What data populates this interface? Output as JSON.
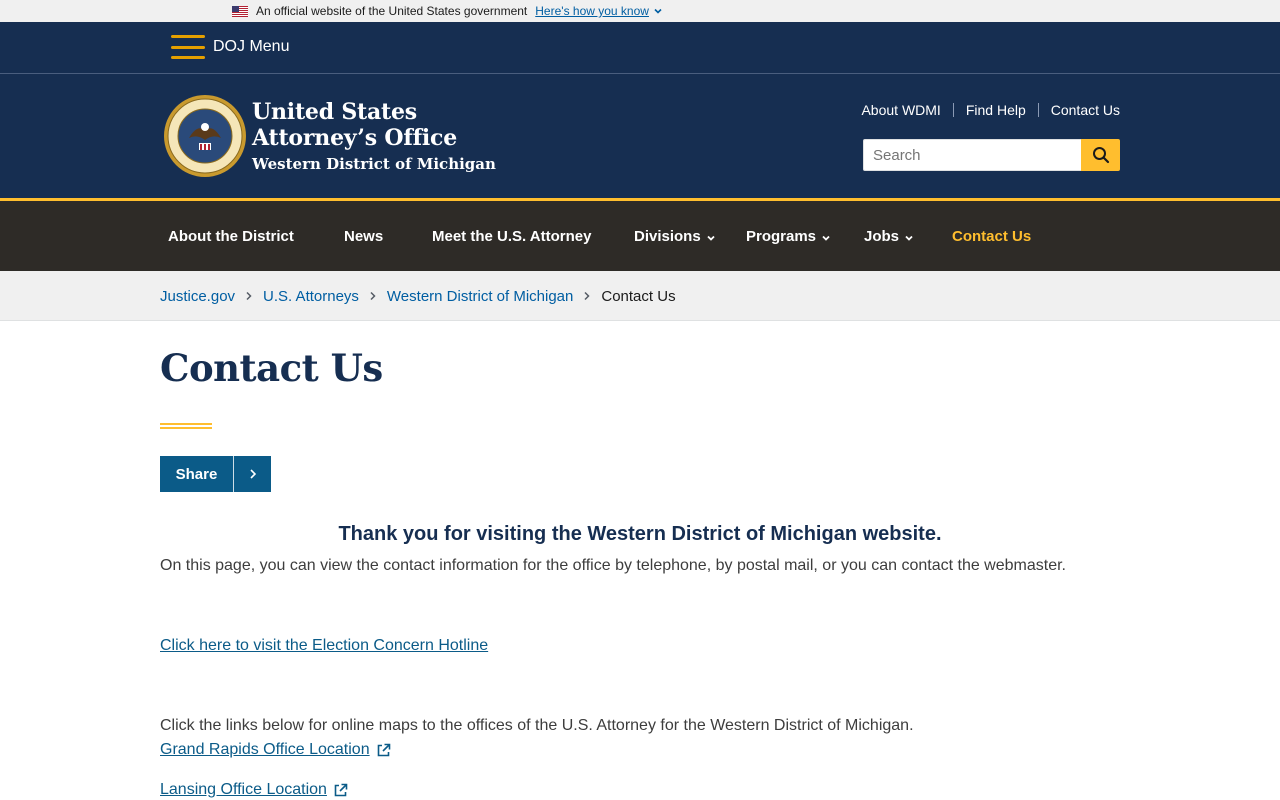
{
  "gov_banner": {
    "text": "An official website of the United States government",
    "link": "Here's how you know"
  },
  "doj_menu": {
    "label": "DOJ Menu"
  },
  "header": {
    "title_line1": "United States",
    "title_line2": "Attorney’s Office",
    "title_line3": "Western District of Michigan",
    "util_links": [
      "About WDMI",
      "Find Help",
      "Contact Us"
    ],
    "search_placeholder": "Search"
  },
  "nav": {
    "items": [
      {
        "label": "About the District",
        "dropdown": false
      },
      {
        "label": "News",
        "dropdown": false
      },
      {
        "label": "Meet the U.S. Attorney",
        "dropdown": false
      },
      {
        "label": "Divisions",
        "dropdown": true
      },
      {
        "label": "Programs",
        "dropdown": true
      },
      {
        "label": "Jobs",
        "dropdown": true
      },
      {
        "label": "Contact Us",
        "dropdown": false,
        "active": true
      }
    ]
  },
  "breadcrumb": {
    "items": [
      "Justice.gov",
      "U.S. Attorneys",
      "Western District of Michigan"
    ],
    "current": "Contact Us"
  },
  "content": {
    "title": "Contact Us",
    "share_label": "Share",
    "intro_heading": "Thank you for visiting the Western District of Michigan website.",
    "intro_text": "On this page, you can view the contact information for the office by telephone, by postal mail, or you can contact the webmaster.",
    "hotline_link": "Click here to visit the Election Concern Hotline",
    "maps_text": "Click the links below for online maps to the offices of the U.S. Attorney for the Western District of Michigan.",
    "office_links": [
      "Grand Rapids Office Location",
      "Lansing Office Location"
    ]
  },
  "colors": {
    "navy": "#162e51",
    "gold": "#ffbe2e",
    "nav_bg": "#2e2b27",
    "link": "#0b5b88"
  }
}
